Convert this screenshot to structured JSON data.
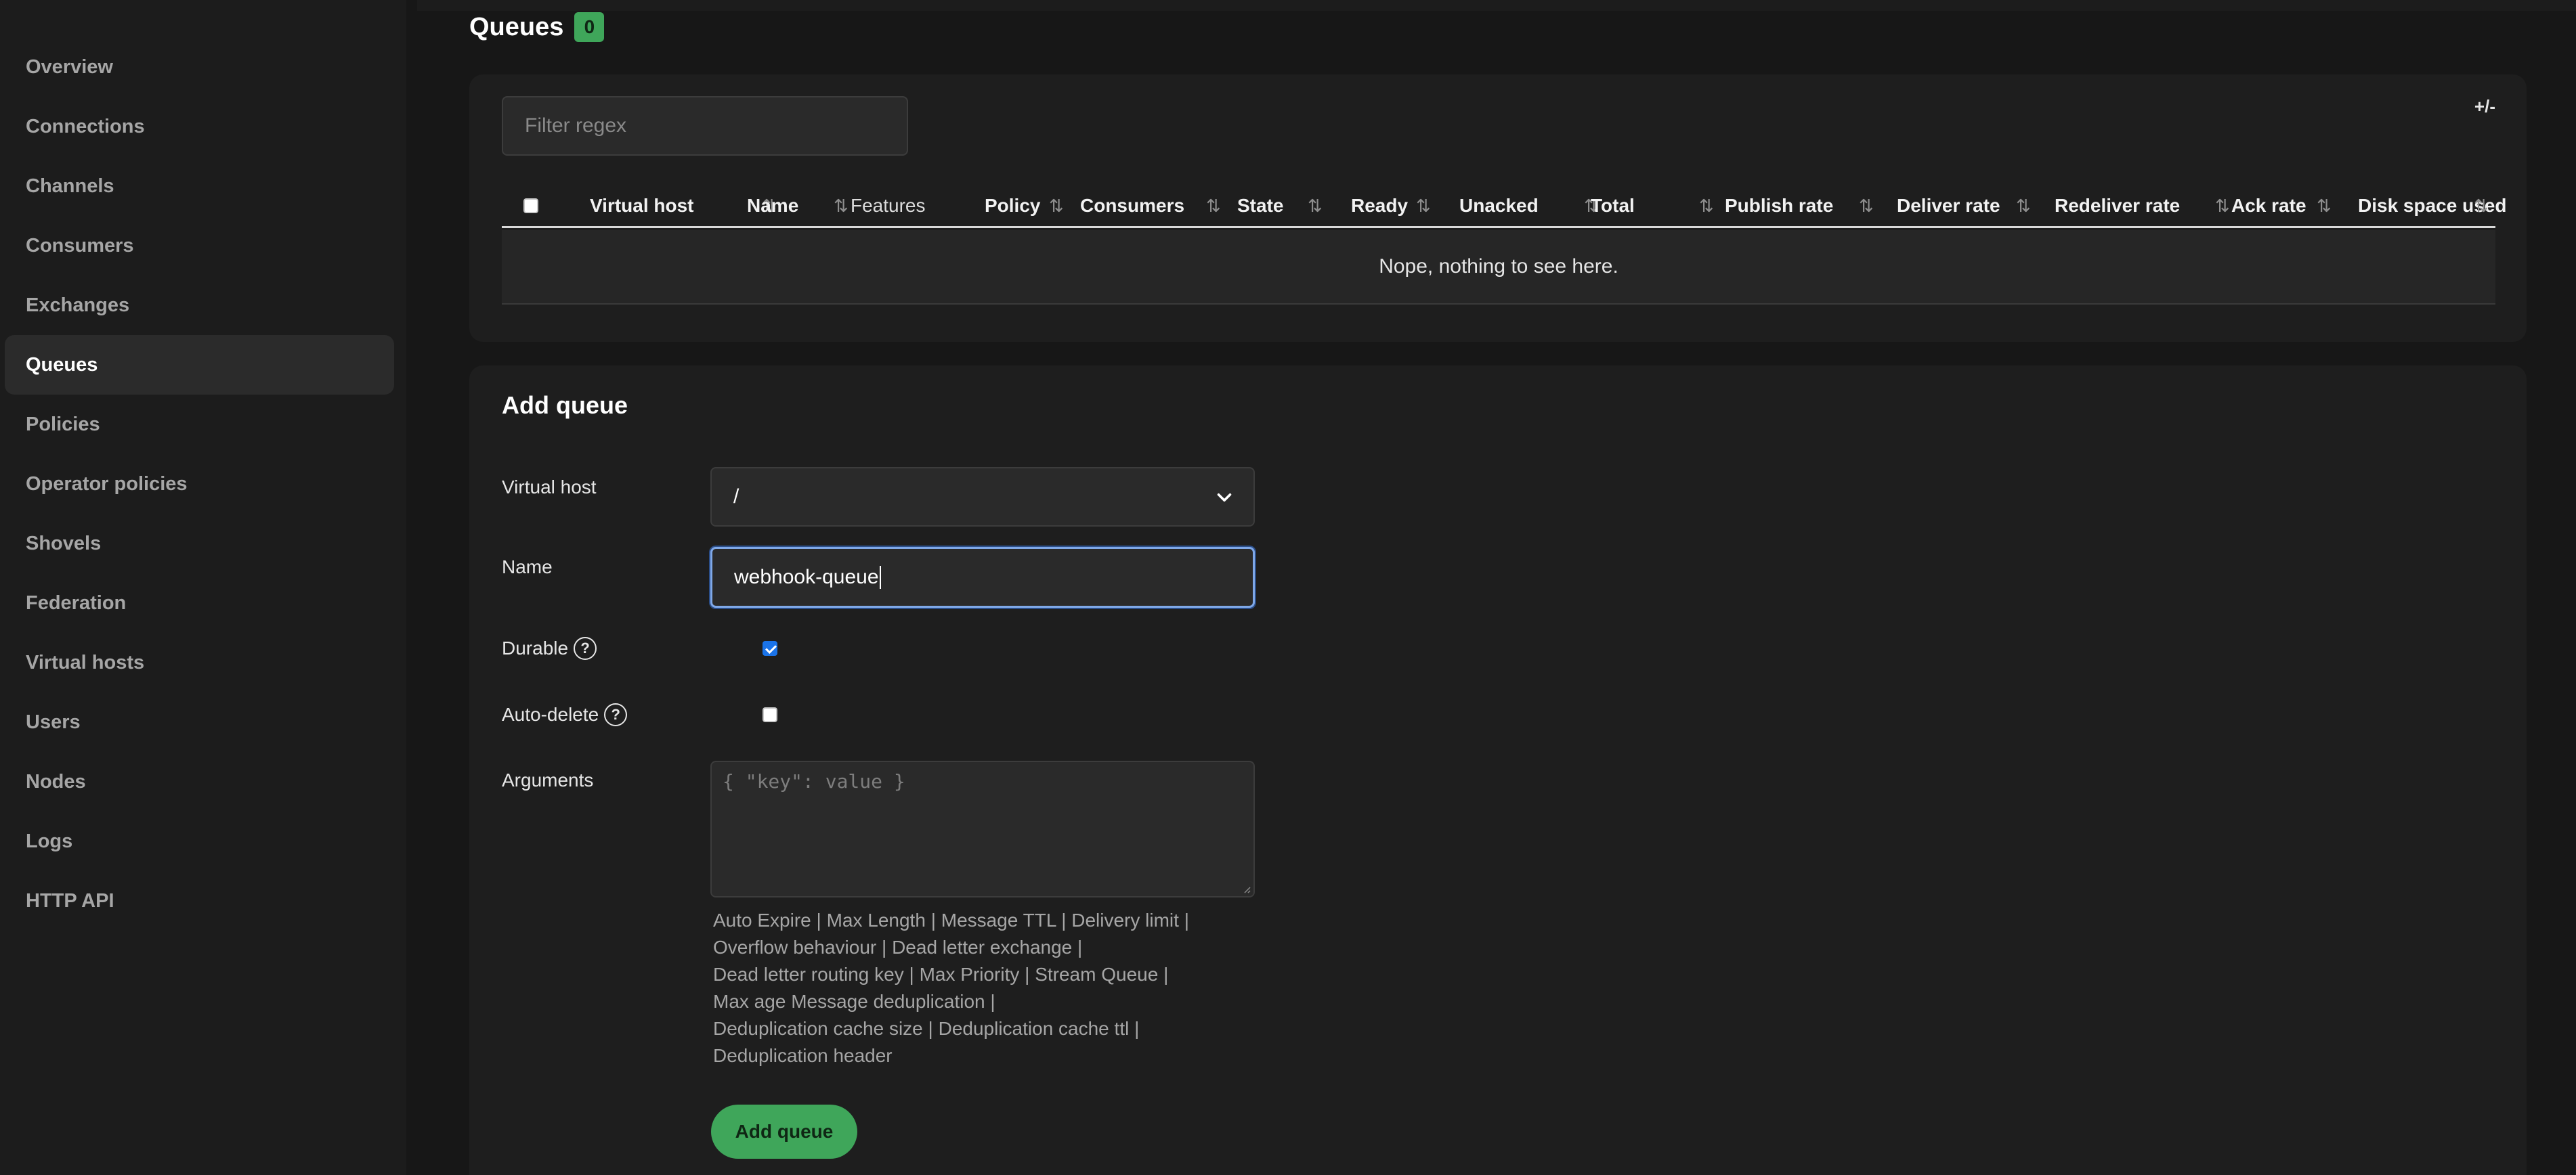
{
  "sidebar": {
    "items": [
      {
        "label": "Overview"
      },
      {
        "label": "Connections"
      },
      {
        "label": "Channels"
      },
      {
        "label": "Consumers"
      },
      {
        "label": "Exchanges"
      },
      {
        "label": "Queues",
        "active": true
      },
      {
        "label": "Policies"
      },
      {
        "label": "Operator policies"
      },
      {
        "label": "Shovels"
      },
      {
        "label": "Federation"
      },
      {
        "label": "Virtual hosts"
      },
      {
        "label": "Users"
      },
      {
        "label": "Nodes"
      },
      {
        "label": "Logs"
      },
      {
        "label": "HTTP API"
      }
    ]
  },
  "queues": {
    "title": "Queues",
    "count": "0",
    "filter_placeholder": "Filter regex",
    "columns_toggle": "+/-",
    "columns": [
      "Virtual host",
      "Name",
      "Features",
      "Policy",
      "Consumers",
      "State",
      "Ready",
      "Unacked",
      "Total",
      "Publish rate",
      "Deliver rate",
      "Redeliver rate",
      "Ack rate",
      "Disk space used"
    ],
    "empty_message": "Nope, nothing to see here."
  },
  "add_queue": {
    "title": "Add queue",
    "virtual_host_label": "Virtual host",
    "virtual_host_value": "/",
    "name_label": "Name",
    "name_value": "webhook-queue",
    "durable_label": "Durable",
    "durable_checked": true,
    "auto_delete_label": "Auto-delete",
    "auto_delete_checked": false,
    "help_glyph": "?",
    "arguments_label": "Arguments",
    "arguments_placeholder": "{ \"key\": value }",
    "argument_links": {
      "auto_expire": "Auto Expire",
      "max_length": "Max Length",
      "message_ttl": "Message TTL",
      "delivery_limit": "Delivery limit",
      "overflow_behaviour": "Overflow behaviour",
      "dead_letter_exchange": "Dead letter exchange",
      "dead_letter_routing_key": "Dead letter routing key",
      "max_priority": "Max Priority",
      "stream_queue": "Stream Queue",
      "max_age": "Max age",
      "message_deduplication": "Message deduplication",
      "deduplication_cache_size": "Deduplication cache size",
      "deduplication_cache_ttl": "Deduplication cache ttl",
      "deduplication_header": "Deduplication header"
    },
    "separator": "|",
    "submit_label": "Add queue"
  },
  "colors": {
    "accent_green": "#3fa65a",
    "focus_blue": "#7fa8e8",
    "checkbox_blue": "#1a73e8"
  }
}
